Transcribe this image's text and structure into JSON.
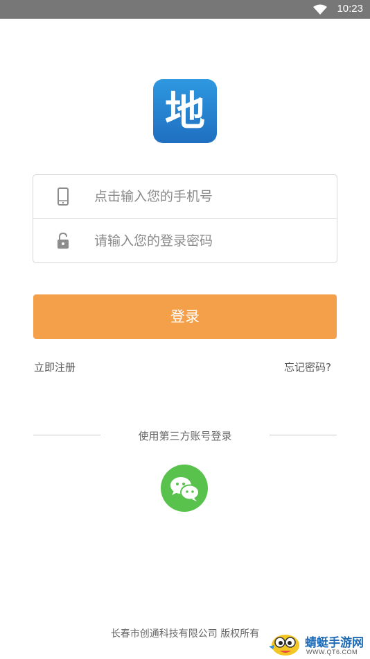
{
  "status_bar": {
    "time": "10:23",
    "wifi_icon": "wifi-icon"
  },
  "logo": {
    "glyph": "地",
    "icon": "app-logo-icon"
  },
  "form": {
    "phone_placeholder": "点击输入您的手机号",
    "phone_value": "",
    "phone_icon": "phone-icon",
    "password_placeholder": "请输入您的登录密码",
    "password_value": "",
    "password_icon": "lock-icon"
  },
  "login_button_label": "登录",
  "links": {
    "register": "立即注册",
    "forgot_password": "忘记密码?"
  },
  "third_party": {
    "label": "使用第三方账号登录",
    "wechat_icon": "wechat-icon"
  },
  "footer": {
    "copyright": "长春市创通科技有限公司 版权所有"
  },
  "watermark": {
    "text": "蜻蜓手游网",
    "url": "WWW.QT6.COM"
  },
  "colors": {
    "accent": "#f4a04b",
    "status_bar": "#777777",
    "logo_blue": "#2379c9",
    "wechat_green": "#58c24d"
  }
}
